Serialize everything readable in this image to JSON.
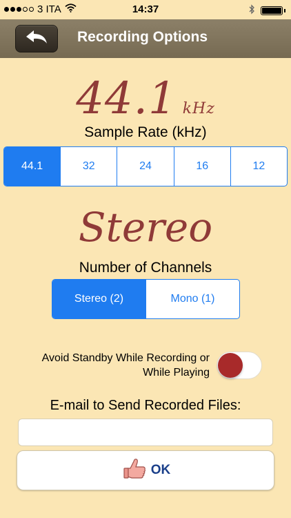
{
  "status_bar": {
    "carrier": "3 ITA",
    "signal_dots_filled": 3,
    "signal_dots_total": 5,
    "time": "14:37",
    "battery_level": 1.0,
    "icons": [
      "wifi-icon",
      "bluetooth-icon",
      "battery-icon"
    ]
  },
  "nav": {
    "title": "Recording Options",
    "back_icon": "back-arrow-icon"
  },
  "sample_rate": {
    "display_value": "44.1",
    "display_unit": "kHz",
    "label": "Sample Rate (kHz)",
    "options": [
      "44.1",
      "32",
      "24",
      "16",
      "12"
    ],
    "selected": "44.1"
  },
  "channels": {
    "display_value": "Stereo",
    "label": "Number of Channels",
    "options": [
      "Stereo (2)",
      "Mono (1)"
    ],
    "selected": "Stereo (2)"
  },
  "standby": {
    "label_line1": "Avoid Standby While Recording or",
    "label_line2": "While Playing",
    "enabled": false
  },
  "email": {
    "label": "E-mail to Send Recorded Files:",
    "value": "",
    "placeholder": ""
  },
  "ok_button": {
    "label": "OK",
    "icon": "thumbs-up-icon"
  },
  "colors": {
    "background": "#fbe6b4",
    "nav_bar": "#7f735b",
    "accent": "#1f7cf0",
    "display_text": "#8f3a38",
    "toggle_knob": "#a82a2a",
    "ok_text": "#1a3f8a"
  }
}
